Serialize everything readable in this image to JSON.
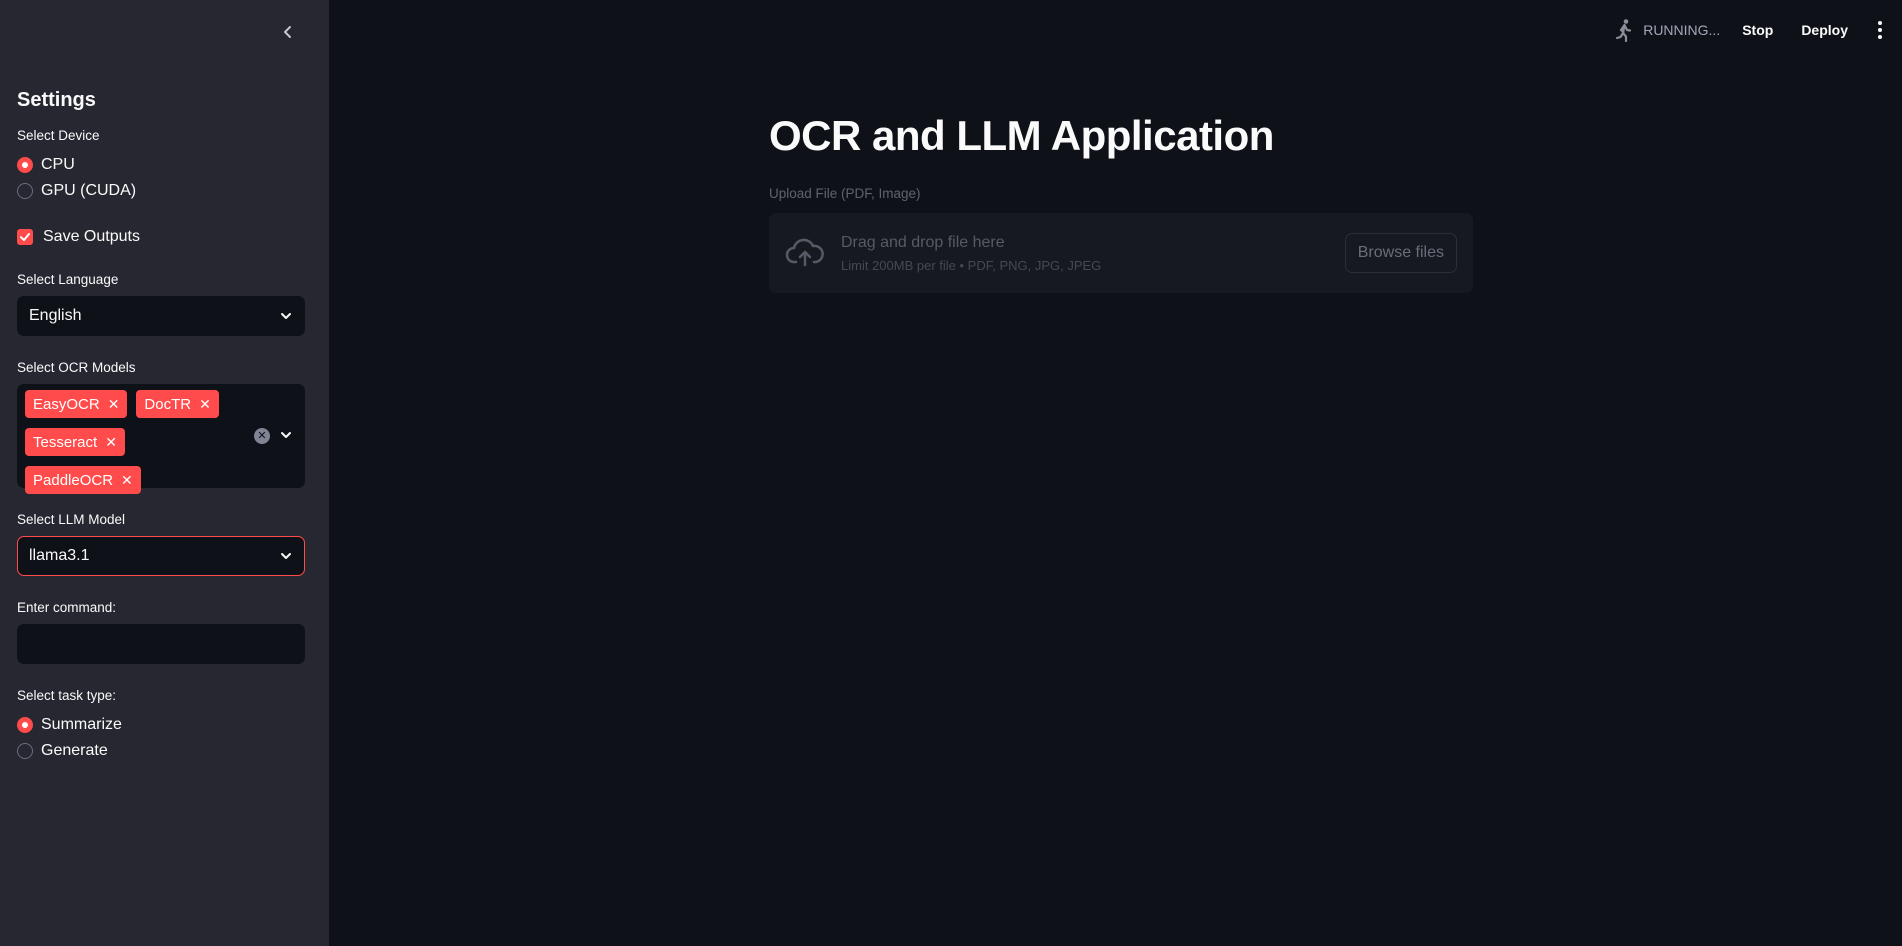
{
  "sidebar": {
    "title": "Settings",
    "device": {
      "label": "Select Device",
      "options": [
        {
          "label": "CPU",
          "selected": true
        },
        {
          "label": "GPU (CUDA)",
          "selected": false
        }
      ]
    },
    "save_outputs": {
      "label": "Save Outputs",
      "checked": true
    },
    "language": {
      "label": "Select Language",
      "value": "English"
    },
    "ocr_models": {
      "label": "Select OCR Models",
      "selected": [
        "EasyOCR",
        "DocTR",
        "Tesseract",
        "PaddleOCR"
      ]
    },
    "llm_model": {
      "label": "Select LLM Model",
      "value": "llama3.1"
    },
    "command": {
      "label": "Enter command:",
      "value": ""
    },
    "task_type": {
      "label": "Select task type:",
      "options": [
        {
          "label": "Summarize",
          "selected": true
        },
        {
          "label": "Generate",
          "selected": false
        }
      ]
    }
  },
  "header": {
    "status": "RUNNING...",
    "stop_label": "Stop",
    "deploy_label": "Deploy"
  },
  "main": {
    "title": "OCR and LLM Application",
    "uploader": {
      "label": "Upload File (PDF, Image)",
      "drop_text": "Drag and drop file here",
      "limit_text": "Limit 200MB per file • PDF, PNG, JPG, JPEG",
      "browse_label": "Browse files"
    }
  },
  "colors": {
    "accent": "#ff4b4b",
    "sidebar_bg": "#262730",
    "main_bg": "#0e1117"
  }
}
